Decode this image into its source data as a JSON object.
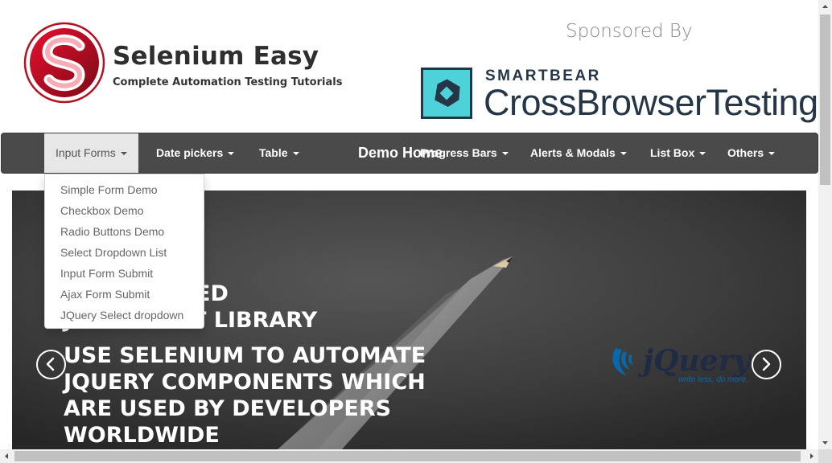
{
  "header": {
    "brand_name": "Selenium Easy",
    "brand_tagline": "Complete Automation Testing Tutorials",
    "sponsored_label": "Sponsored By",
    "sponsor_small": "SMARTBEAR",
    "sponsor_big": "CrossBrowserTesting",
    "logo_icon": "selenium-easy-logo",
    "sponsor_icon": "smartbear-cbt-logo"
  },
  "navbar": {
    "brand": "Demo Home",
    "items": [
      {
        "label": "Input Forms",
        "active": true
      },
      {
        "label": "Date pickers"
      },
      {
        "label": "Table"
      },
      {
        "label": "Progress Bars"
      },
      {
        "label": "Alerts & Modals"
      },
      {
        "label": "List Box"
      },
      {
        "label": "Others"
      }
    ]
  },
  "dropdown": {
    "items": [
      "Simple Form Demo",
      "Checkbox Demo",
      "Radio Buttons Demo",
      "Select Dropdown List",
      "Input Form Submit",
      "Ajax Form Submit",
      "JQuery Select dropdown"
    ]
  },
  "carousel": {
    "headline_line1": "WIDELY USED",
    "headline_line2": "JAVASCRIPT LIBRARY",
    "body_lines": [
      "USE SELENIUM TO AUTOMATE",
      "JQUERY COMPONENTS WHICH",
      "ARE USED BY DEVELOPERS",
      "WORLDWIDE"
    ],
    "logo_text": "jQuery",
    "logo_tagline": "write less, do more.",
    "prev_icon": "chevron-left-icon",
    "next_icon": "chevron-right-icon"
  },
  "colors": {
    "navbar_bg": "#4a4a4a",
    "active_tab_bg": "#e7e7e7",
    "brand_red": "#c8102e",
    "sponsor_teal": "#4fd1d9",
    "sponsor_navy": "#253746",
    "jquery_blue": "#0769ad"
  }
}
